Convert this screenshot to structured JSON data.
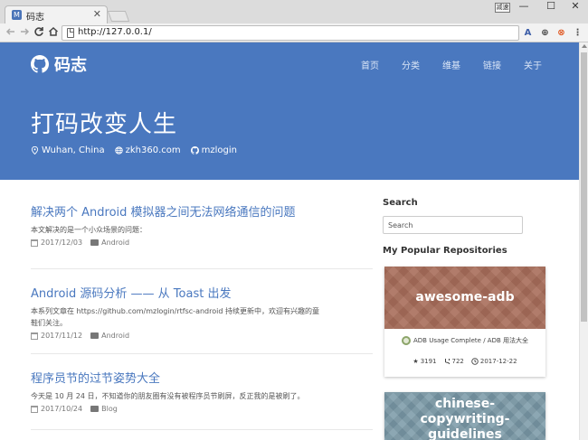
{
  "browser": {
    "tab_title": "码志",
    "tab_close": "✕",
    "url": "http://127.0.0.1/",
    "window_badge": "减速",
    "minimize": "—",
    "maximize": "☐",
    "close": "✕",
    "extensions": [
      "A",
      "⊕",
      "⊗",
      "⋮"
    ]
  },
  "site": {
    "logo_text": "码志",
    "nav": [
      "首页",
      "分类",
      "维基",
      "链接",
      "关于"
    ],
    "hero_title": "打码改变人生",
    "location": "Wuhan, China",
    "website": "zkh360.com",
    "github": "mzlogin"
  },
  "posts": [
    {
      "title": "解决两个 Android 模拟器之间无法网络通信的问题",
      "excerpt": "本文解决的是一个小众场景的问题：",
      "date": "2017/12/03",
      "category": "Android"
    },
    {
      "title": "Android 源码分析 —— 从 Toast 出发",
      "excerpt": "本系列文章在 https://github.com/mzlogin/rtfsc-android 持续更新中，欢迎有兴趣的童鞋们关注。",
      "date": "2017/11/12",
      "category": "Android"
    },
    {
      "title": "程序员节的过节姿势大全",
      "excerpt": "今天是 10 月 24 日，不知道你的朋友圈有没有被程序员节刷屏，反正我的是被刷了。",
      "date": "2017/10/24",
      "category": "Blog"
    }
  ],
  "sidebar": {
    "search_heading": "Search",
    "search_placeholder": "Search",
    "repos_heading": "My Popular Repositories",
    "repos": [
      {
        "name": "awesome-adb",
        "description": "ADB Usage Complete / ADB 用法大全",
        "stars": "3191",
        "forks": "722",
        "updated": "2017-12-22"
      },
      {
        "name": "chinese-copywriting-guidelines"
      }
    ]
  },
  "colors": {
    "hero": "#4a78bf",
    "link": "#4a78bf",
    "adb_cover": "#a86d5a",
    "cn_cover": "#7b9aa8"
  }
}
